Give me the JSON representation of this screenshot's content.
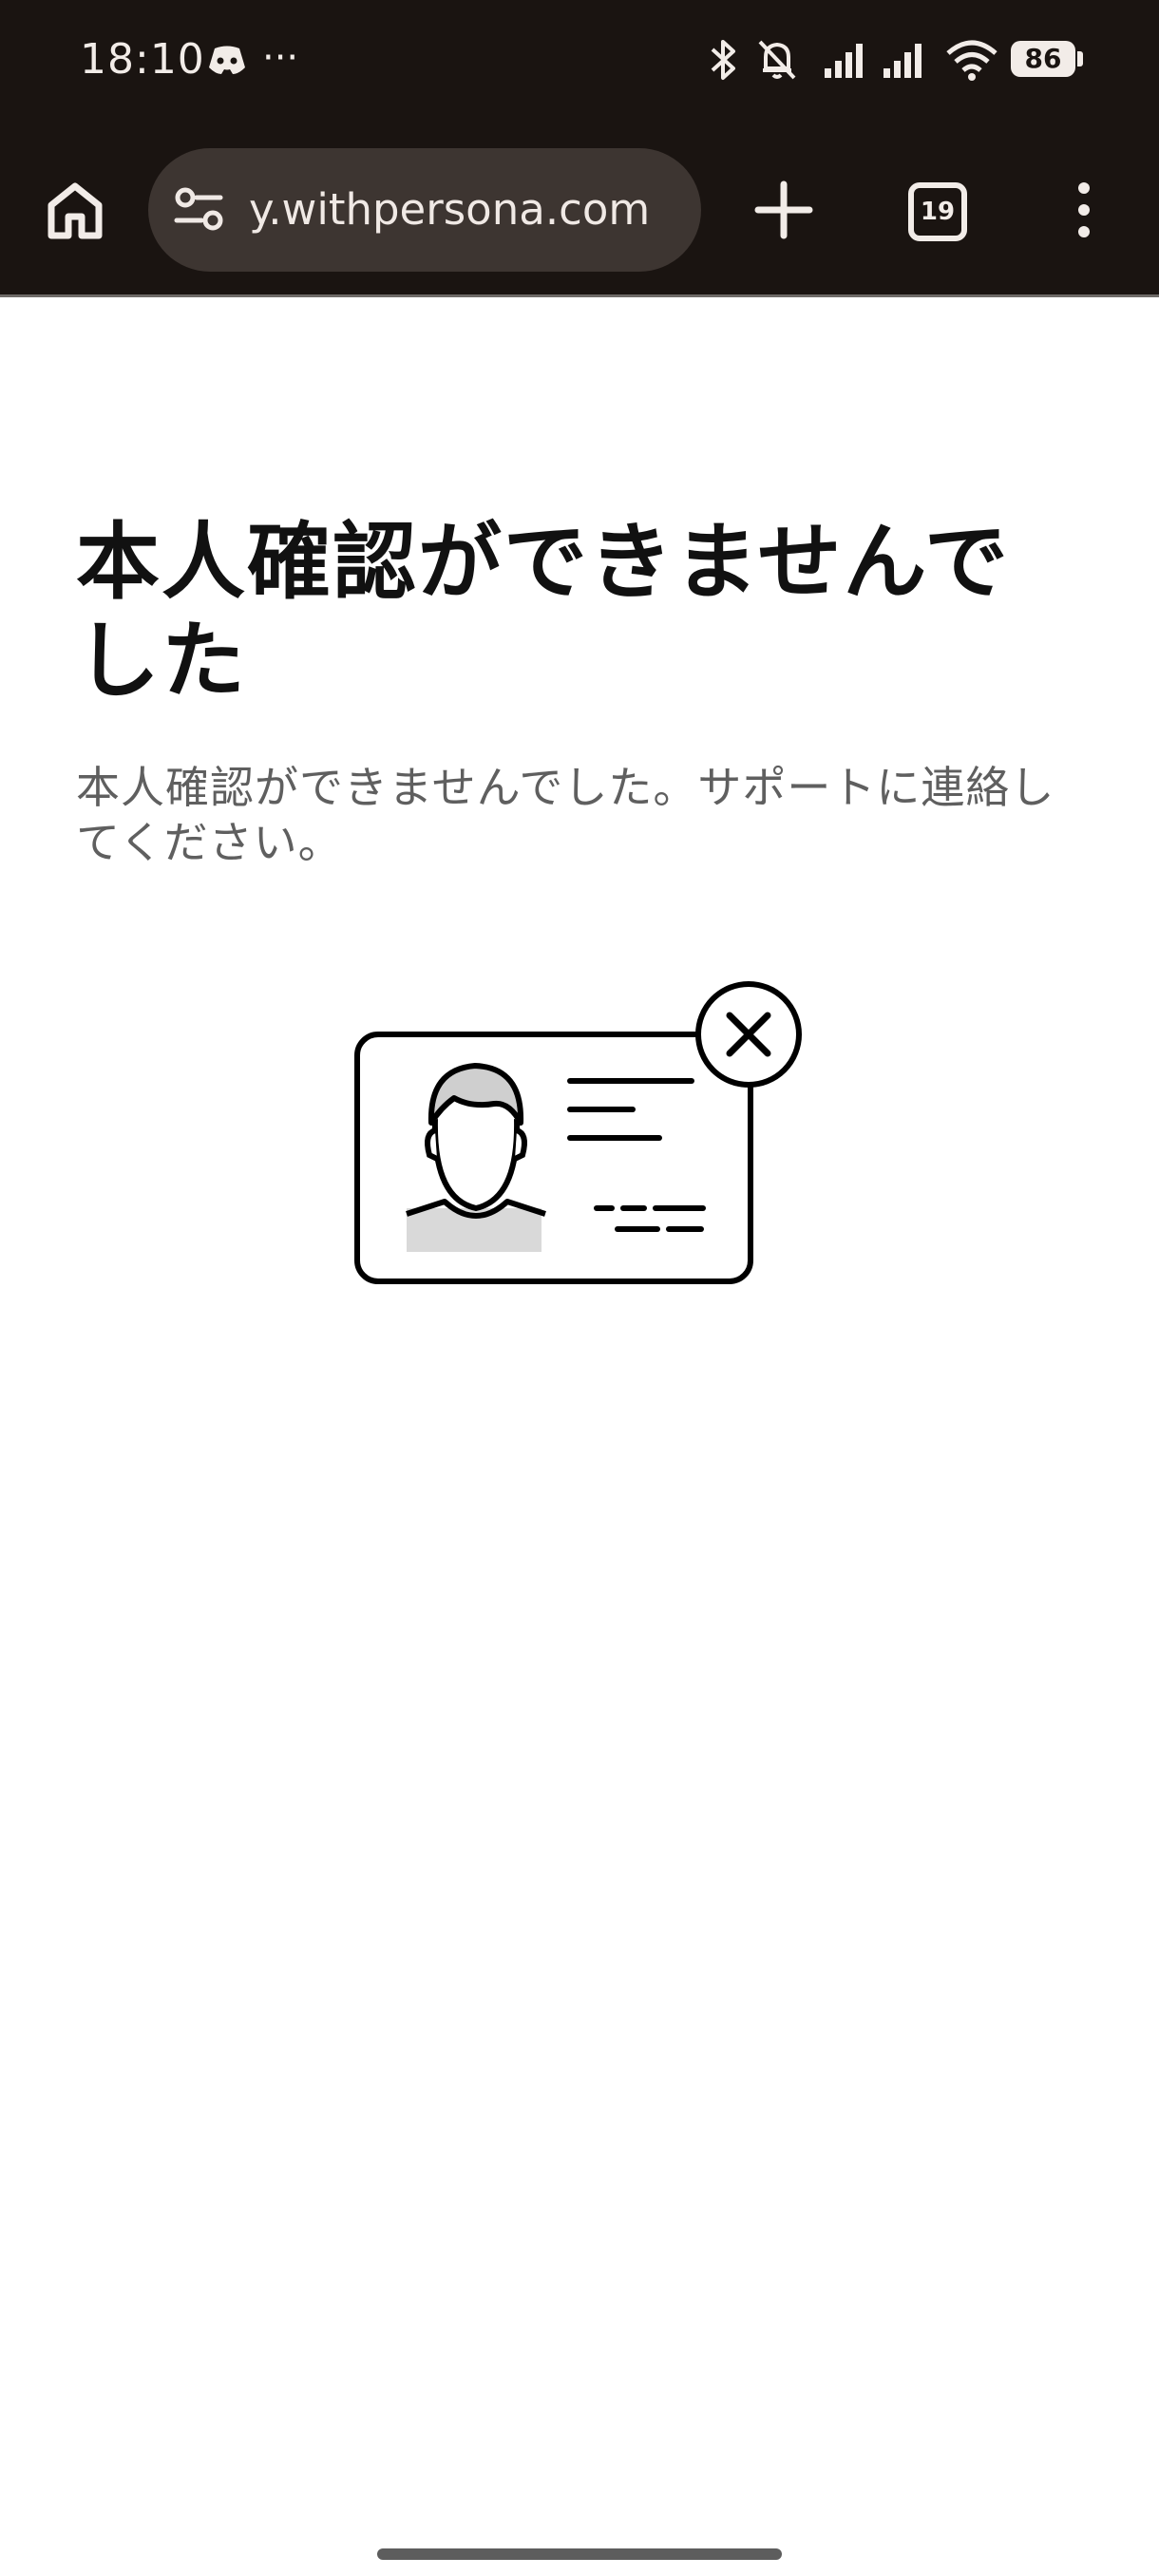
{
  "status_bar": {
    "time": "18:10",
    "overflow": "···",
    "battery": "86",
    "icons": [
      "discord-icon",
      "bluetooth-icon",
      "mute-icon",
      "signal-icon",
      "signal-icon",
      "wifi-icon",
      "battery-icon"
    ]
  },
  "browser": {
    "url": "y.withpersona.com",
    "tab_count": "19",
    "icons": [
      "home-icon",
      "site-settings-icon",
      "new-tab-icon",
      "tab-switcher-icon",
      "more-icon"
    ]
  },
  "main": {
    "title": "本人確認ができませんでした",
    "description": "本人確認ができませんでした。サポートに連絡してください。",
    "illustration": "id-card-error-icon"
  },
  "colors": {
    "chrome_background": "#1a1411",
    "address_bar": "#3d3531",
    "title_text": "#111111",
    "description_text": "#5f5f5f"
  }
}
